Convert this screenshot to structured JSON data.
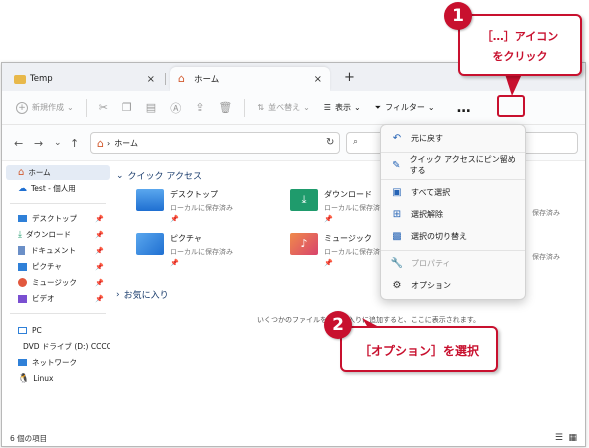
{
  "tabs": [
    {
      "label": "Temp"
    },
    {
      "label": "ホーム"
    }
  ],
  "tab_close": "×",
  "tab_new": "+",
  "toolbar": {
    "new_label": "新規作成",
    "sort_label": "並べ替え",
    "view_label": "表示",
    "filter_label": "フィルター",
    "more_label": "…"
  },
  "address": {
    "path": "ホーム",
    "separator": "›"
  },
  "sidebar": {
    "items": [
      {
        "label": "ホーム"
      },
      {
        "label": "Test - 個人用"
      },
      {
        "label": "デスクトップ"
      },
      {
        "label": "ダウンロード"
      },
      {
        "label": "ドキュメント"
      },
      {
        "label": "ピクチャ"
      },
      {
        "label": "ミュージック"
      },
      {
        "label": "ビデオ"
      },
      {
        "label": "PC"
      },
      {
        "label": "DVD ドライブ (D:) CCCC"
      },
      {
        "label": "ネットワーク"
      },
      {
        "label": "Linux"
      }
    ]
  },
  "main": {
    "quick_access": "クイック アクセス",
    "favorites": "お気に入り",
    "empty_hint": "いくつかのファイルをお気に入りに追加すると、ここに表示されます。",
    "folders": [
      {
        "name": "デスクトップ",
        "sub": "ローカルに保存済み"
      },
      {
        "name": "ダウンロード",
        "sub": "ローカルに保存済み"
      },
      {
        "name": "ピクチャ",
        "sub": "ローカルに保存済み"
      },
      {
        "name": "ミュージック",
        "sub": "ローカルに保存済み"
      },
      {
        "name": "",
        "sub": "保存済み"
      },
      {
        "name": "",
        "sub": "保存済み"
      }
    ]
  },
  "status": {
    "count": "6 個の項目"
  },
  "menu": {
    "items": [
      {
        "label": "元に戻す"
      },
      {
        "label": "クイック アクセスにピン留めする"
      },
      {
        "label": "すべて選択"
      },
      {
        "label": "選択解除"
      },
      {
        "label": "選択の切り替え"
      },
      {
        "label": "プロパティ"
      },
      {
        "label": "オプション"
      }
    ]
  },
  "callouts": {
    "one_num": "1",
    "one_text_line1": "［…］アイコン",
    "one_text_line2": "をクリック",
    "two_num": "2",
    "two_text": "［オプション］を選択"
  },
  "colors": {
    "accent": "#c8102e",
    "folder_blue": "#2f80d8",
    "folder_green": "#1f9b6c"
  }
}
